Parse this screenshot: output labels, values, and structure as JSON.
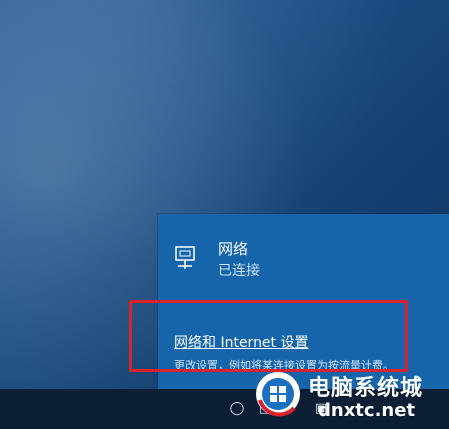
{
  "flyout": {
    "network_name": "网络",
    "network_status": "已连接",
    "settings_link": "网络和 Internet 设置",
    "settings_description": "更改设置，例如将某连接设置为按流量计费。"
  },
  "taskbar": {
    "tray_icons": [
      "person-icon",
      "network-icon",
      "volume-icon",
      "ime-icon"
    ]
  },
  "watermark": {
    "title": "电脑系统城",
    "domain": "dnxtc.net"
  },
  "colors": {
    "flyout_bg": "#1665ab",
    "highlight": "#d8232c",
    "taskbar_bg": "#0c1f35"
  }
}
